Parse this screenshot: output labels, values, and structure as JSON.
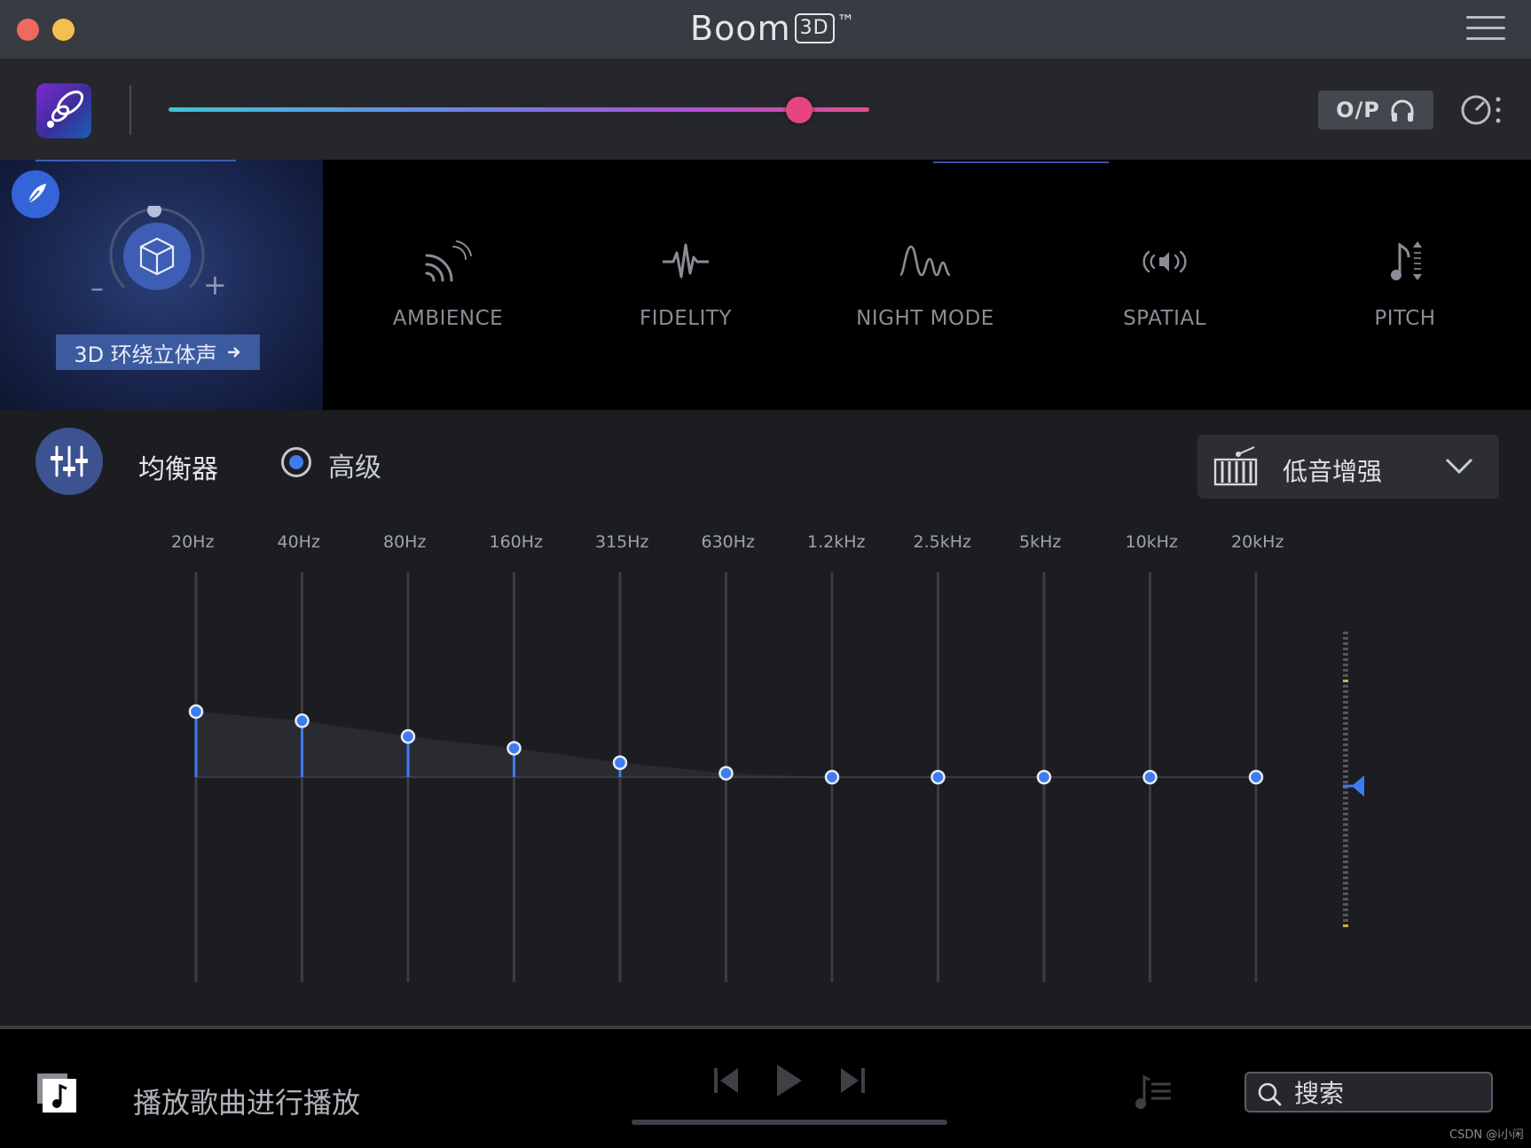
{
  "window": {
    "title": "Boom",
    "title_badge": "3D",
    "title_mark": "™"
  },
  "volume": {
    "level": 0.9
  },
  "output": {
    "label": "O/P"
  },
  "surround": {
    "label": "3D 环绕立体声",
    "minus": "–",
    "plus": "+"
  },
  "effects": [
    {
      "label": "AMBIENCE",
      "icon": "ambience-icon"
    },
    {
      "label": "FIDELITY",
      "icon": "fidelity-icon"
    },
    {
      "label": "NIGHT MODE",
      "icon": "night-mode-icon"
    },
    {
      "label": "SPATIAL",
      "icon": "spatial-icon"
    },
    {
      "label": "PITCH",
      "icon": "pitch-icon"
    }
  ],
  "equalizer": {
    "title": "均衡器",
    "mode_label": "高级",
    "mode_selected": true,
    "preset": "低音增强",
    "bands": [
      {
        "label": "20Hz",
        "level": 0.5
      },
      {
        "label": "40Hz",
        "level": 0.43
      },
      {
        "label": "80Hz",
        "level": 0.31
      },
      {
        "label": "160Hz",
        "level": 0.22
      },
      {
        "label": "315Hz",
        "level": 0.11
      },
      {
        "label": "630Hz",
        "level": 0.03
      },
      {
        "label": "1.2kHz",
        "level": 0
      },
      {
        "label": "2.5kHz",
        "level": 0
      },
      {
        "label": "5kHz",
        "level": 0
      },
      {
        "label": "10kHz",
        "level": 0
      },
      {
        "label": "20kHz",
        "level": 0
      }
    ],
    "accent_color": "#3d7cf0"
  },
  "player": {
    "now_playing": "播放歌曲进行播放",
    "search_placeholder": "搜索"
  },
  "watermark": "CSDN @i小闲"
}
